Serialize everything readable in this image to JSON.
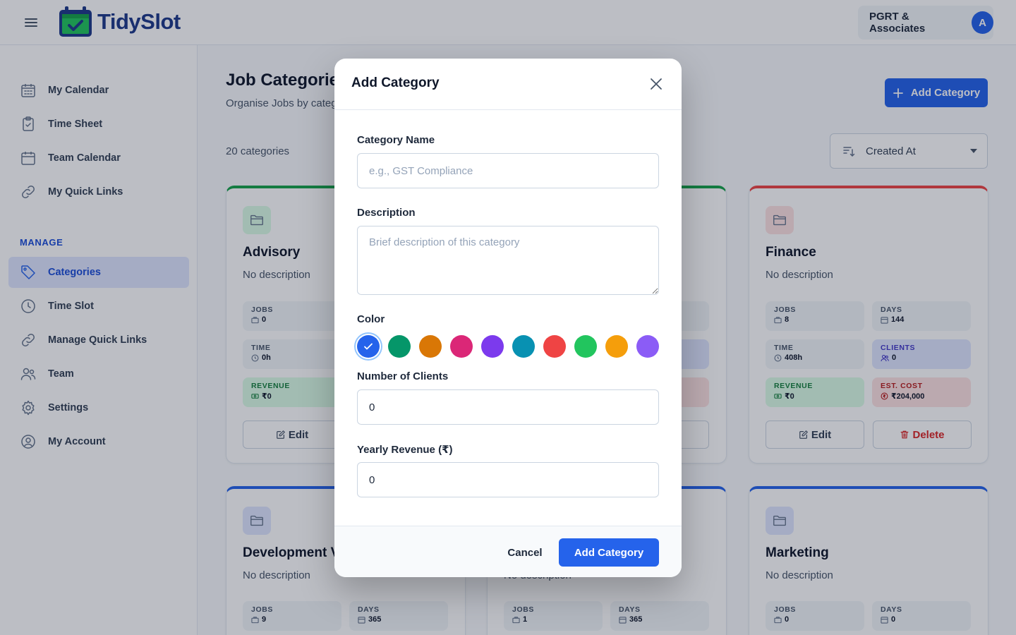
{
  "app": {
    "name": "TidySlot",
    "org_name": "PGRT & Associates",
    "avatar_initial": "A"
  },
  "sidebar": {
    "items": [
      {
        "label": "My Calendar",
        "icon": "calendar-grid-icon"
      },
      {
        "label": "Time Sheet",
        "icon": "clipboard-check-icon"
      },
      {
        "label": "Team Calendar",
        "icon": "calendar-icon"
      },
      {
        "label": "My Quick Links",
        "icon": "link-icon"
      }
    ],
    "section_label": "MANAGE",
    "manage_items": [
      {
        "label": "Categories",
        "icon": "tag-icon",
        "active": true
      },
      {
        "label": "Time Slot",
        "icon": "clock-icon"
      },
      {
        "label": "Manage Quick Links",
        "icon": "link-icon"
      },
      {
        "label": "Team",
        "icon": "users-icon"
      },
      {
        "label": "Settings",
        "icon": "gear-icon"
      },
      {
        "label": "My Account",
        "icon": "user-circle-icon"
      }
    ]
  },
  "main": {
    "title": "Job Categories",
    "subtitle": "Organise Jobs by categ",
    "count_text": "20 categories",
    "add_button_label": "Add Category",
    "sort_label": "Created At"
  },
  "cards": [
    {
      "name": "Advisory",
      "description": "No description",
      "accent": "#16a34a",
      "stats": {
        "jobs_label": "JOBS",
        "jobs": "0",
        "time_label": "TIME",
        "time": "0h",
        "revenue_label": "REVENUE",
        "revenue": "₹0"
      },
      "edit_label": "Edit"
    },
    {
      "name": "Finance",
      "description": "No description",
      "accent": "#ef4444",
      "stats": {
        "jobs_label": "JOBS",
        "jobs": "8",
        "days_label": "DAYS",
        "days": "144",
        "time_label": "TIME",
        "time": "408h",
        "clients_label": "CLIENTS",
        "clients": "0",
        "revenue_label": "REVENUE",
        "revenue": "₹0",
        "cost_label": "EST. COST",
        "cost": "₹204,000"
      },
      "edit_label": "Edit",
      "delete_label": "Delete"
    },
    {
      "name": "Development V",
      "description": "No description",
      "accent": "#2563eb",
      "stats": {
        "jobs_label": "JOBS",
        "jobs": "9",
        "days_label": "DAYS",
        "days": "365"
      }
    },
    {
      "name": "",
      "description": "No description",
      "accent": "#2563eb",
      "stats": {
        "jobs_label": "JOBS",
        "jobs": "1",
        "days_label": "DAYS",
        "days": "365"
      }
    },
    {
      "name": "Marketing",
      "description": "No description",
      "accent": "#2563eb",
      "stats": {
        "jobs_label": "JOBS",
        "jobs": "0",
        "days_label": "DAYS",
        "days": "0"
      }
    }
  ],
  "modal": {
    "title": "Add Category",
    "name_label": "Category Name",
    "name_placeholder": "e.g., GST Compliance",
    "description_label": "Description",
    "description_placeholder": "Brief description of this category",
    "color_label": "Color",
    "colors": [
      "#2563eb",
      "#059669",
      "#d97706",
      "#db2777",
      "#7c3aed",
      "#0891b2",
      "#ef4444",
      "#22c55e",
      "#f59e0b",
      "#8b5cf6"
    ],
    "selected_color": "#2563eb",
    "clients_label": "Number of Clients",
    "clients_value": "0",
    "revenue_label": "Yearly Revenue (₹)",
    "revenue_value": "0",
    "cancel_label": "Cancel",
    "submit_label": "Add Category"
  }
}
